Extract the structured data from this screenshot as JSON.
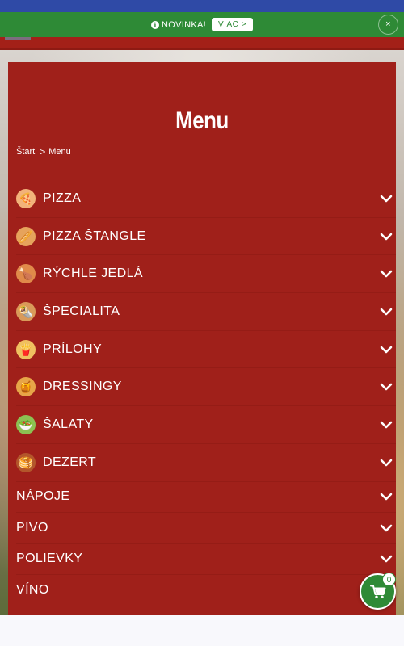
{
  "notice": {
    "info_icon": "i",
    "text": "NOVINKA!",
    "more_label": "VIAC >",
    "close_label": "×"
  },
  "page": {
    "title": "Menu"
  },
  "breadcrumb": {
    "home": "Štart",
    "separator": ">",
    "current": "Menu"
  },
  "menu": {
    "items": [
      {
        "label": "PIZZA",
        "icon": "pizza-icon",
        "glyph": "🍕",
        "color": "#f2b27a"
      },
      {
        "label": "PIZZA ŠTANGLE",
        "icon": "breadstick-icon",
        "glyph": "🥖",
        "color": "#e6a35c"
      },
      {
        "label": "RÝCHLE JEDLÁ",
        "icon": "fast-food-icon",
        "glyph": "🍗",
        "color": "#e08a4a"
      },
      {
        "label": "ŠPECIALITA",
        "icon": "wrap-icon",
        "glyph": "🌯",
        "color": "#d99a5a"
      },
      {
        "label": "PRÍLOHY",
        "icon": "fries-icon",
        "glyph": "🍟",
        "color": "#f0c060"
      },
      {
        "label": "DRESSINGY",
        "icon": "sauce-bottle-icon",
        "glyph": "🍯",
        "color": "#e7a548"
      },
      {
        "label": "ŠALATY",
        "icon": "salad-icon",
        "glyph": "🥗",
        "color": "#8cc152"
      },
      {
        "label": "DEZERT",
        "icon": "pancake-icon",
        "glyph": "🥞",
        "color": "#b3562b"
      },
      {
        "label": "NÁPOJE"
      },
      {
        "label": "PIVO"
      },
      {
        "label": "POLIEVKY"
      },
      {
        "label": "VÍNO"
      }
    ]
  },
  "cart": {
    "count": "0",
    "icon": "cart-icon"
  },
  "colors": {
    "brand_red": "#a0201a",
    "brand_green": "#2e8a36",
    "top_blue": "#2f4aa6"
  }
}
